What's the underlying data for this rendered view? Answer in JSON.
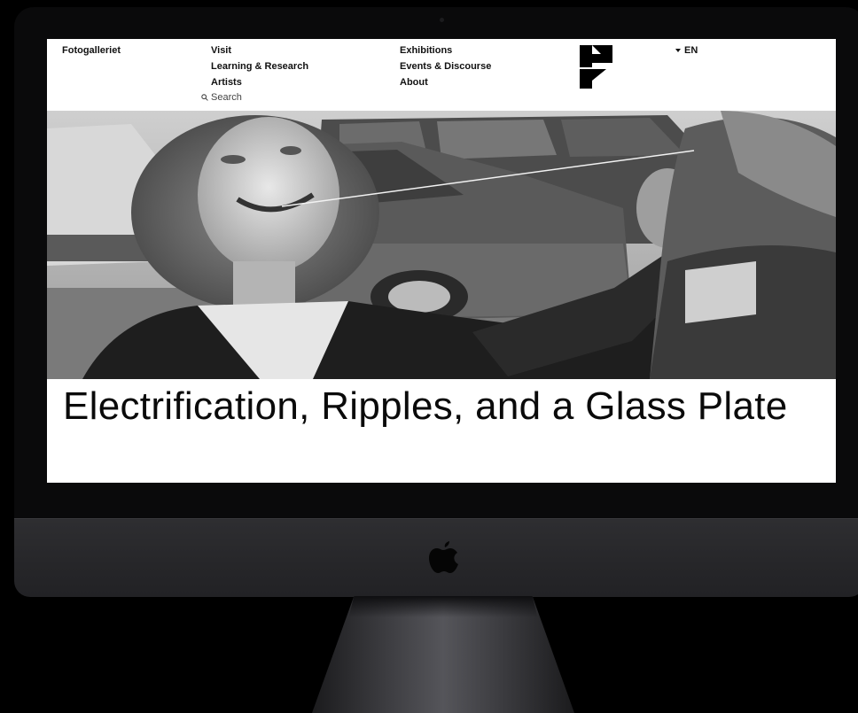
{
  "nav": {
    "brand": "Fotogalleriet",
    "col1": [
      "Visit",
      "Learning & Research",
      "Artists"
    ],
    "col2": [
      "Exhibitions",
      "Events & Discourse",
      "About"
    ],
    "search_label": "Search",
    "language": "EN"
  },
  "page": {
    "title": "Electrification, Ripples, and a Glass Plate"
  },
  "colors": {
    "background": "#000000",
    "screen": "#ffffff",
    "text": "#111111"
  }
}
